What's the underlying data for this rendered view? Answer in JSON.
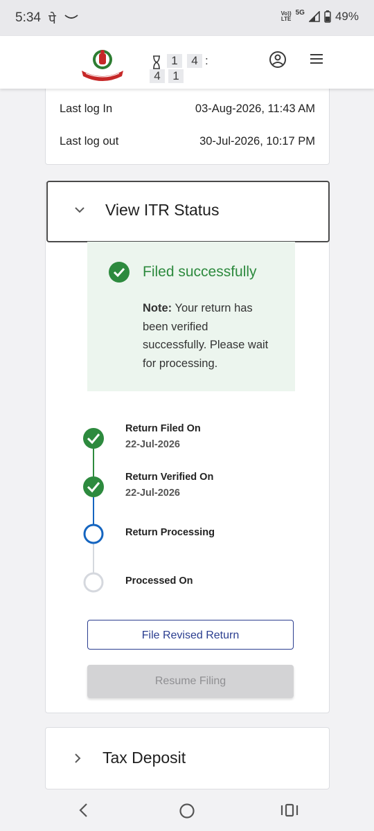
{
  "status_bar": {
    "time": "5:34",
    "indicator": "पे",
    "network_top": "Vo))",
    "network_bottom": "LTE",
    "network_5g": "5G",
    "battery": "49%"
  },
  "header": {
    "logo_alt": "INCOME TAX DEPARTMENT",
    "timer": {
      "d1": "1",
      "d2": "4",
      "sep": ":",
      "d3": "4",
      "d4": "1"
    }
  },
  "login_info": {
    "last_login_label": "Last log In",
    "last_login_value": "03-Aug-2026, 11:43 AM",
    "last_logout_label": "Last log out",
    "last_logout_value": "30-Jul-2026, 10:17 PM"
  },
  "itr_status": {
    "title": "View ITR Status",
    "status_title": "Filed successfully",
    "note_label": "Note:",
    "note_text": " Your return has been verified successfully. Please wait for processing.",
    "steps": [
      {
        "title": "Return Filed On",
        "date": "22-Jul-2026",
        "state": "done"
      },
      {
        "title": "Return Verified On",
        "date": "22-Jul-2026",
        "state": "done"
      },
      {
        "title": "Return Processing",
        "date": "",
        "state": "current"
      },
      {
        "title": "Processed On",
        "date": "",
        "state": "pending"
      }
    ],
    "file_revised_label": "File Revised Return",
    "resume_filing_label": "Resume Filing"
  },
  "tax_deposit": {
    "title": "Tax Deposit"
  },
  "colors": {
    "success_green": "#2d8a3e",
    "current_blue": "#1565c0",
    "pending_grey": "#d5d8de",
    "primary_navy": "#2a3d8f"
  },
  "icons": [
    "hourglass-icon",
    "profile-icon",
    "menu-icon",
    "chevron-down-icon",
    "check-circle-icon",
    "chevron-right-icon",
    "back-icon",
    "home-icon",
    "recents-icon"
  ]
}
